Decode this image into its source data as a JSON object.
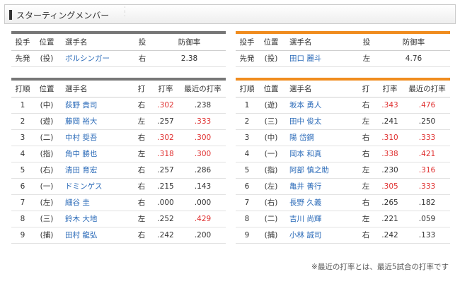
{
  "header": {
    "title": "スターティングメンバー"
  },
  "pitcher_headers": [
    "投手",
    "位置",
    "選手名",
    "投",
    "防御率"
  ],
  "lineup_headers": [
    "打順",
    "位置",
    "選手名",
    "打",
    "打率",
    "最近の打率"
  ],
  "left": {
    "pitcher": {
      "role": "先発",
      "pos": "(投)",
      "name": "ボルシンガー",
      "hand": "右",
      "era": "2.38"
    },
    "lineup": [
      {
        "order": "1",
        "pos": "(中)",
        "name": "荻野 貴司",
        "hand": "右",
        "avg": ".302",
        "recent": ".238"
      },
      {
        "order": "2",
        "pos": "(遊)",
        "name": "藤岡 裕大",
        "hand": "左",
        "avg": ".257",
        "recent": ".333"
      },
      {
        "order": "3",
        "pos": "(二)",
        "name": "中村 奨吾",
        "hand": "右",
        "avg": ".302",
        "recent": ".300"
      },
      {
        "order": "4",
        "pos": "(指)",
        "name": "角中 勝也",
        "hand": "左",
        "avg": ".318",
        "recent": ".300"
      },
      {
        "order": "5",
        "pos": "(右)",
        "name": "清田 育宏",
        "hand": "右",
        "avg": ".257",
        "recent": ".286"
      },
      {
        "order": "6",
        "pos": "(一)",
        "name": "ドミンゲス",
        "hand": "右",
        "avg": ".215",
        "recent": ".143"
      },
      {
        "order": "7",
        "pos": "(左)",
        "name": "細谷 圭",
        "hand": "右",
        "avg": ".000",
        "recent": ".000"
      },
      {
        "order": "8",
        "pos": "(三)",
        "name": "鈴木 大地",
        "hand": "左",
        "avg": ".252",
        "recent": ".429"
      },
      {
        "order": "9",
        "pos": "(捕)",
        "name": "田村 龍弘",
        "hand": "右",
        "avg": ".242",
        "recent": ".200"
      }
    ]
  },
  "right": {
    "pitcher": {
      "role": "先発",
      "pos": "(投)",
      "name": "田口 麗斗",
      "hand": "左",
      "era": "4.76"
    },
    "lineup": [
      {
        "order": "1",
        "pos": "(遊)",
        "name": "坂本 勇人",
        "hand": "右",
        "avg": ".343",
        "recent": ".476"
      },
      {
        "order": "2",
        "pos": "(三)",
        "name": "田中 俊太",
        "hand": "左",
        "avg": ".241",
        "recent": ".250"
      },
      {
        "order": "3",
        "pos": "(中)",
        "name": "陽 岱鋼",
        "hand": "右",
        "avg": ".310",
        "recent": ".333"
      },
      {
        "order": "4",
        "pos": "(一)",
        "name": "岡本 和真",
        "hand": "右",
        "avg": ".338",
        "recent": ".421"
      },
      {
        "order": "5",
        "pos": "(指)",
        "name": "阿部 慎之助",
        "hand": "左",
        "avg": ".230",
        "recent": ".316"
      },
      {
        "order": "6",
        "pos": "(左)",
        "name": "亀井 善行",
        "hand": "左",
        "avg": ".305",
        "recent": ".333"
      },
      {
        "order": "7",
        "pos": "(右)",
        "name": "長野 久義",
        "hand": "右",
        "avg": ".265",
        "recent": ".182"
      },
      {
        "order": "8",
        "pos": "(二)",
        "name": "吉川 尚輝",
        "hand": "左",
        "avg": ".221",
        "recent": ".059"
      },
      {
        "order": "9",
        "pos": "(捕)",
        "name": "小林 誠司",
        "hand": "右",
        "avg": ".242",
        "recent": ".133"
      }
    ]
  },
  "highlight": {
    "threshold": 0.3,
    "color": "#e03131"
  },
  "note": "※最近の打率とは、最近5試合の打率です"
}
